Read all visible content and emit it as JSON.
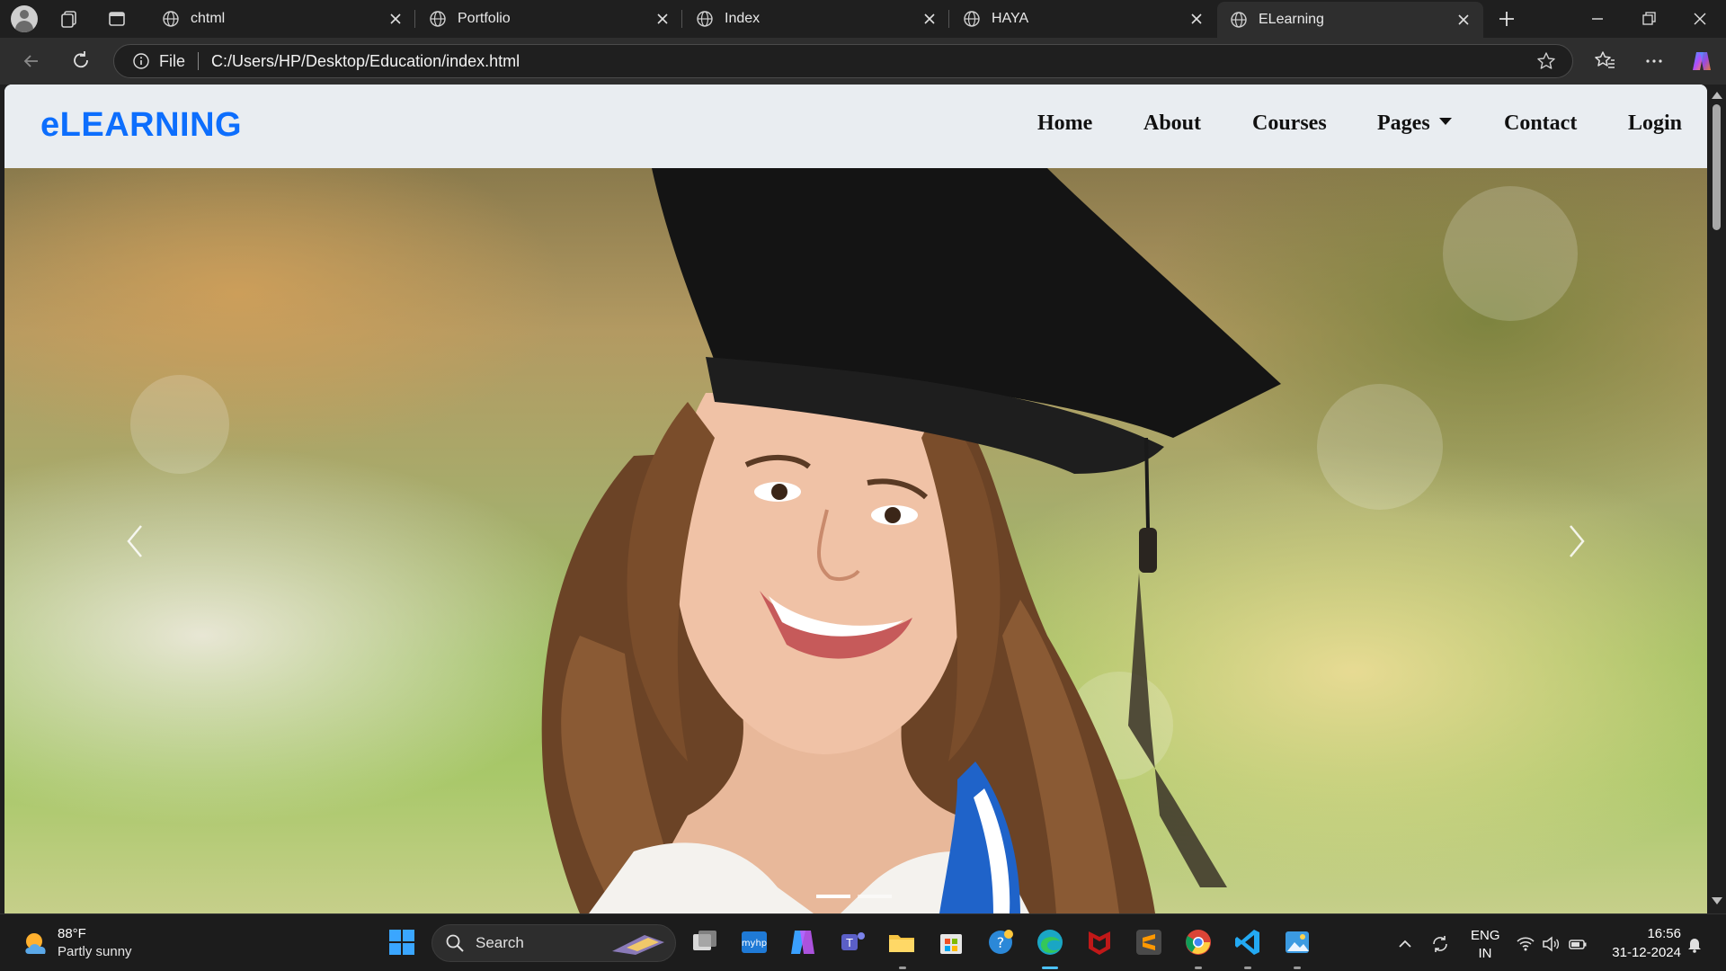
{
  "browser": {
    "tabs": [
      {
        "title": "chtml",
        "active": false
      },
      {
        "title": "Portfolio",
        "active": false
      },
      {
        "title": "Index",
        "active": false
      },
      {
        "title": "HAYA",
        "active": false
      },
      {
        "title": "ELearning",
        "active": true
      }
    ],
    "address": {
      "scheme_label": "File",
      "url": "C:/Users/HP/Desktop/Education/index.html"
    }
  },
  "page": {
    "brand": "eLEARNING",
    "nav": {
      "home": "Home",
      "about": "About",
      "courses": "Courses",
      "pages": "Pages",
      "contact": "Contact",
      "login": "Login"
    },
    "carousel": {
      "slide_count": 2,
      "active_slide": 1
    },
    "colors": {
      "brand": "#0d6efd",
      "navbar_bg": "#e9edf1"
    }
  },
  "taskbar": {
    "weather": {
      "temp": "88°F",
      "desc": "Partly sunny"
    },
    "search_placeholder": "Search",
    "language": {
      "line1": "ENG",
      "line2": "IN"
    },
    "clock": {
      "time": "16:56",
      "date": "31-12-2024"
    }
  }
}
